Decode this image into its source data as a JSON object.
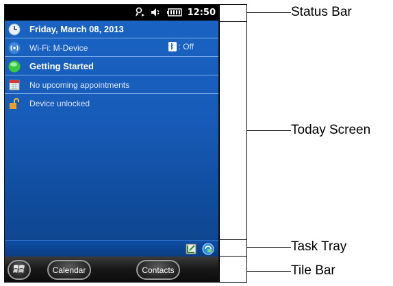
{
  "status_bar": {
    "time": "12:50",
    "icons": [
      "phone-alert-icon",
      "speaker-muted-icon",
      "battery-icon"
    ]
  },
  "today": {
    "date": "Friday, March 08, 2013",
    "wifi": "Wi-Fi: M-Device",
    "bluetooth": ": Off",
    "getting_started": "Getting Started",
    "appointments": "No upcoming appointments",
    "device_lock": "Device unlocked"
  },
  "tile_bar": {
    "calendar": "Calendar",
    "contacts": "Contacts"
  },
  "annotations": {
    "status_bar": "Status Bar",
    "today_screen": "Today Screen",
    "task_tray": "Task Tray",
    "tile_bar": "Tile Bar"
  },
  "colors": {
    "screen_blue": "#175bb8",
    "status_black": "#000000",
    "tile_dark": "#181818"
  }
}
